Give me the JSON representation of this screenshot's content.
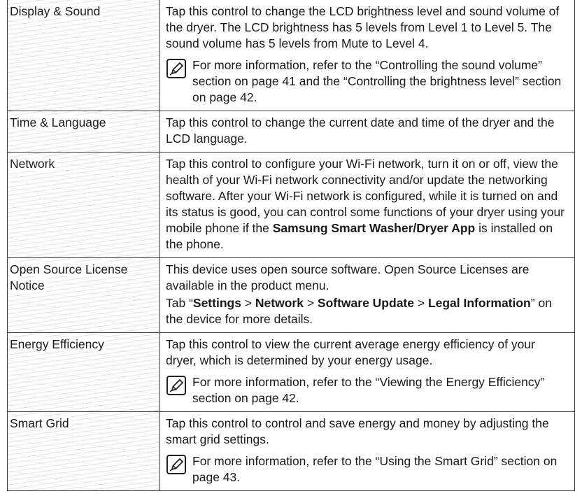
{
  "rows": [
    {
      "label": "Display & Sound",
      "desc": "Tap this control to change the LCD brightness level and sound volume of the dryer. The LCD brightness has 5 levels from Level 1 to Level 5. The sound volume has 5 levels from Mute to Level 4.",
      "note": {
        "p1": "For more information, refer to the “",
        "b1": "Controlling the sound volume",
        "p2": "” section on page 41 and the “",
        "b2": "Controlling the brightness level",
        "p3": "” section on page 42."
      }
    },
    {
      "label": "Time & Language",
      "desc": "Tap this control to change the current date and time of the dryer and the LCD language."
    },
    {
      "label": "Network",
      "desc_a": "Tap this control to configure your Wi-Fi network, turn it on or off, view the health of your Wi-Fi network connectivity and/or update the networking software. After your Wi-Fi network is configured, while it is turned on and its status is good, you can control some functions of your dryer using your mobile phone if the ",
      "desc_bold": "Samsung Smart Washer/Dryer App",
      "desc_b": " is installed on the phone."
    },
    {
      "label": "Open Source License Notice",
      "desc": "This device uses open source software. Open Source Licenses are available in the product menu.",
      "tab": {
        "t1": "Tab “",
        "b1": "Settings",
        "t2": " > ",
        "b2": "Network",
        "t3": " > ",
        "b3": "Software Update",
        "t4": " > ",
        "b4": "Legal Information",
        "t5": "” on the device for more details."
      }
    },
    {
      "label": "Energy Efficiency",
      "desc": "Tap this control to view the current average energy efficiency of your dryer, which is determined by your energy usage.",
      "note": {
        "p1": "For more information, refer to the “",
        "b1": "Viewing the Energy Efficiency",
        "p2": "” section on page 42."
      }
    },
    {
      "label": "Smart Grid",
      "desc": "Tap this control to control and save energy and money by adjusting the smart grid settings.",
      "note": {
        "p1": "For more information, refer to the “",
        "b1": "Using the Smart Grid",
        "p2": "” section on page 43."
      }
    }
  ],
  "note_icon": "note-pencil-icon"
}
